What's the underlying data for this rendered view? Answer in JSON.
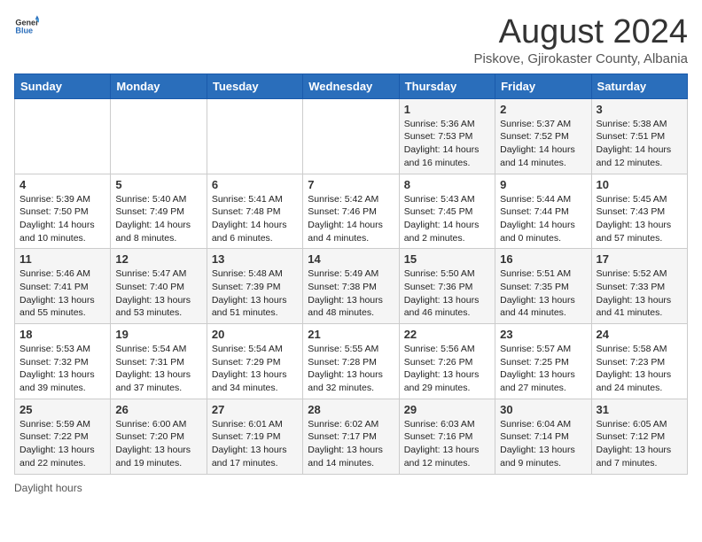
{
  "header": {
    "logo_general": "General",
    "logo_blue": "Blue",
    "title": "August 2024",
    "subtitle": "Piskove, Gjirokaster County, Albania"
  },
  "days_of_week": [
    "Sunday",
    "Monday",
    "Tuesday",
    "Wednesday",
    "Thursday",
    "Friday",
    "Saturday"
  ],
  "weeks": [
    [
      {
        "day": "",
        "info": ""
      },
      {
        "day": "",
        "info": ""
      },
      {
        "day": "",
        "info": ""
      },
      {
        "day": "",
        "info": ""
      },
      {
        "day": "1",
        "info": "Sunrise: 5:36 AM\nSunset: 7:53 PM\nDaylight: 14 hours\nand 16 minutes."
      },
      {
        "day": "2",
        "info": "Sunrise: 5:37 AM\nSunset: 7:52 PM\nDaylight: 14 hours\nand 14 minutes."
      },
      {
        "day": "3",
        "info": "Sunrise: 5:38 AM\nSunset: 7:51 PM\nDaylight: 14 hours\nand 12 minutes."
      }
    ],
    [
      {
        "day": "4",
        "info": "Sunrise: 5:39 AM\nSunset: 7:50 PM\nDaylight: 14 hours\nand 10 minutes."
      },
      {
        "day": "5",
        "info": "Sunrise: 5:40 AM\nSunset: 7:49 PM\nDaylight: 14 hours\nand 8 minutes."
      },
      {
        "day": "6",
        "info": "Sunrise: 5:41 AM\nSunset: 7:48 PM\nDaylight: 14 hours\nand 6 minutes."
      },
      {
        "day": "7",
        "info": "Sunrise: 5:42 AM\nSunset: 7:46 PM\nDaylight: 14 hours\nand 4 minutes."
      },
      {
        "day": "8",
        "info": "Sunrise: 5:43 AM\nSunset: 7:45 PM\nDaylight: 14 hours\nand 2 minutes."
      },
      {
        "day": "9",
        "info": "Sunrise: 5:44 AM\nSunset: 7:44 PM\nDaylight: 14 hours\nand 0 minutes."
      },
      {
        "day": "10",
        "info": "Sunrise: 5:45 AM\nSunset: 7:43 PM\nDaylight: 13 hours\nand 57 minutes."
      }
    ],
    [
      {
        "day": "11",
        "info": "Sunrise: 5:46 AM\nSunset: 7:41 PM\nDaylight: 13 hours\nand 55 minutes."
      },
      {
        "day": "12",
        "info": "Sunrise: 5:47 AM\nSunset: 7:40 PM\nDaylight: 13 hours\nand 53 minutes."
      },
      {
        "day": "13",
        "info": "Sunrise: 5:48 AM\nSunset: 7:39 PM\nDaylight: 13 hours\nand 51 minutes."
      },
      {
        "day": "14",
        "info": "Sunrise: 5:49 AM\nSunset: 7:38 PM\nDaylight: 13 hours\nand 48 minutes."
      },
      {
        "day": "15",
        "info": "Sunrise: 5:50 AM\nSunset: 7:36 PM\nDaylight: 13 hours\nand 46 minutes."
      },
      {
        "day": "16",
        "info": "Sunrise: 5:51 AM\nSunset: 7:35 PM\nDaylight: 13 hours\nand 44 minutes."
      },
      {
        "day": "17",
        "info": "Sunrise: 5:52 AM\nSunset: 7:33 PM\nDaylight: 13 hours\nand 41 minutes."
      }
    ],
    [
      {
        "day": "18",
        "info": "Sunrise: 5:53 AM\nSunset: 7:32 PM\nDaylight: 13 hours\nand 39 minutes."
      },
      {
        "day": "19",
        "info": "Sunrise: 5:54 AM\nSunset: 7:31 PM\nDaylight: 13 hours\nand 37 minutes."
      },
      {
        "day": "20",
        "info": "Sunrise: 5:54 AM\nSunset: 7:29 PM\nDaylight: 13 hours\nand 34 minutes."
      },
      {
        "day": "21",
        "info": "Sunrise: 5:55 AM\nSunset: 7:28 PM\nDaylight: 13 hours\nand 32 minutes."
      },
      {
        "day": "22",
        "info": "Sunrise: 5:56 AM\nSunset: 7:26 PM\nDaylight: 13 hours\nand 29 minutes."
      },
      {
        "day": "23",
        "info": "Sunrise: 5:57 AM\nSunset: 7:25 PM\nDaylight: 13 hours\nand 27 minutes."
      },
      {
        "day": "24",
        "info": "Sunrise: 5:58 AM\nSunset: 7:23 PM\nDaylight: 13 hours\nand 24 minutes."
      }
    ],
    [
      {
        "day": "25",
        "info": "Sunrise: 5:59 AM\nSunset: 7:22 PM\nDaylight: 13 hours\nand 22 minutes."
      },
      {
        "day": "26",
        "info": "Sunrise: 6:00 AM\nSunset: 7:20 PM\nDaylight: 13 hours\nand 19 minutes."
      },
      {
        "day": "27",
        "info": "Sunrise: 6:01 AM\nSunset: 7:19 PM\nDaylight: 13 hours\nand 17 minutes."
      },
      {
        "day": "28",
        "info": "Sunrise: 6:02 AM\nSunset: 7:17 PM\nDaylight: 13 hours\nand 14 minutes."
      },
      {
        "day": "29",
        "info": "Sunrise: 6:03 AM\nSunset: 7:16 PM\nDaylight: 13 hours\nand 12 minutes."
      },
      {
        "day": "30",
        "info": "Sunrise: 6:04 AM\nSunset: 7:14 PM\nDaylight: 13 hours\nand 9 minutes."
      },
      {
        "day": "31",
        "info": "Sunrise: 6:05 AM\nSunset: 7:12 PM\nDaylight: 13 hours\nand 7 minutes."
      }
    ]
  ],
  "footer": {
    "daylight_hours_label": "Daylight hours"
  }
}
